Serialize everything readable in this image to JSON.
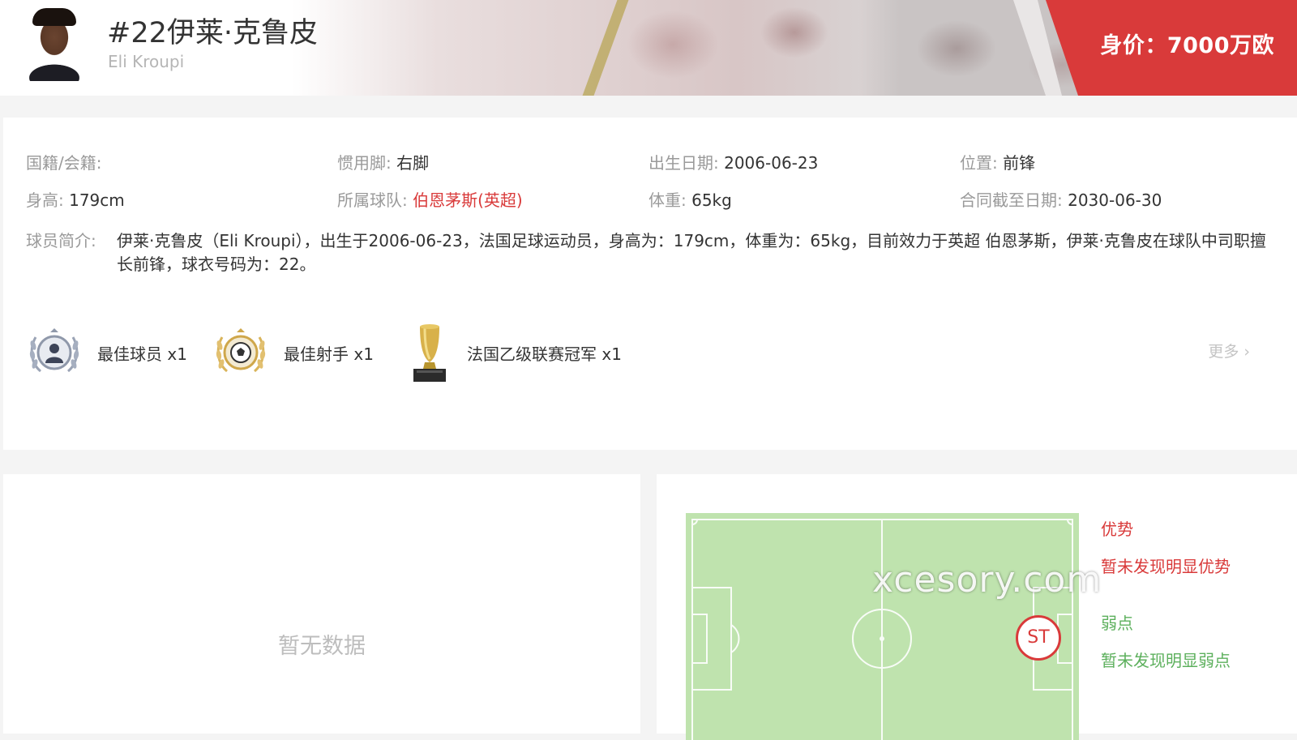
{
  "header": {
    "name": "#22伊莱·克鲁皮",
    "name_en": "Eli Kroupi",
    "market_value": "身价：7000万欧"
  },
  "info": {
    "nationality_label": "国籍/会籍:",
    "nationality_value": "",
    "foot_label": "惯用脚:",
    "foot_value": "右脚",
    "birth_label": "出生日期:",
    "birth_value": "2006-06-23",
    "position_label": "位置:",
    "position_value": "前锋",
    "height_label": "身高:",
    "height_value": "179cm",
    "team_label": "所属球队:",
    "team_value": "伯恩茅斯(英超)",
    "weight_label": "体重:",
    "weight_value": "65kg",
    "contract_label": "合同截至日期:",
    "contract_value": "2030-06-30",
    "intro_label": "球员简介:",
    "intro_text": "伊莱·克鲁皮（Eli Kroupi），出生于2006-06-23，法国足球运动员，身高为：179cm，体重为：65kg，目前效力于英超 伯恩茅斯，伊莱·克鲁皮在球队中司职擅长前锋，球衣号码为：22。"
  },
  "honors": [
    {
      "label": "最佳球员 x1",
      "icon": "best-player-laurel-icon"
    },
    {
      "label": "最佳射手 x1",
      "icon": "top-scorer-laurel-icon"
    },
    {
      "label": "法国乙级联赛冠军 x1",
      "icon": "trophy-icon"
    }
  ],
  "honors_more": "更多",
  "stats_panel": {
    "empty_text": "暂无数据"
  },
  "position_panel": {
    "marker": "ST",
    "strength_title": "优势",
    "strength_text": "暂未发现明显优势",
    "weakness_title": "弱点",
    "weakness_text": "暂未发现明显弱点"
  },
  "watermark": "xcesory.com",
  "colors": {
    "accent_red": "#d93a3a",
    "weak_green": "#5db05d",
    "pitch_green": "#bfe3ae"
  }
}
